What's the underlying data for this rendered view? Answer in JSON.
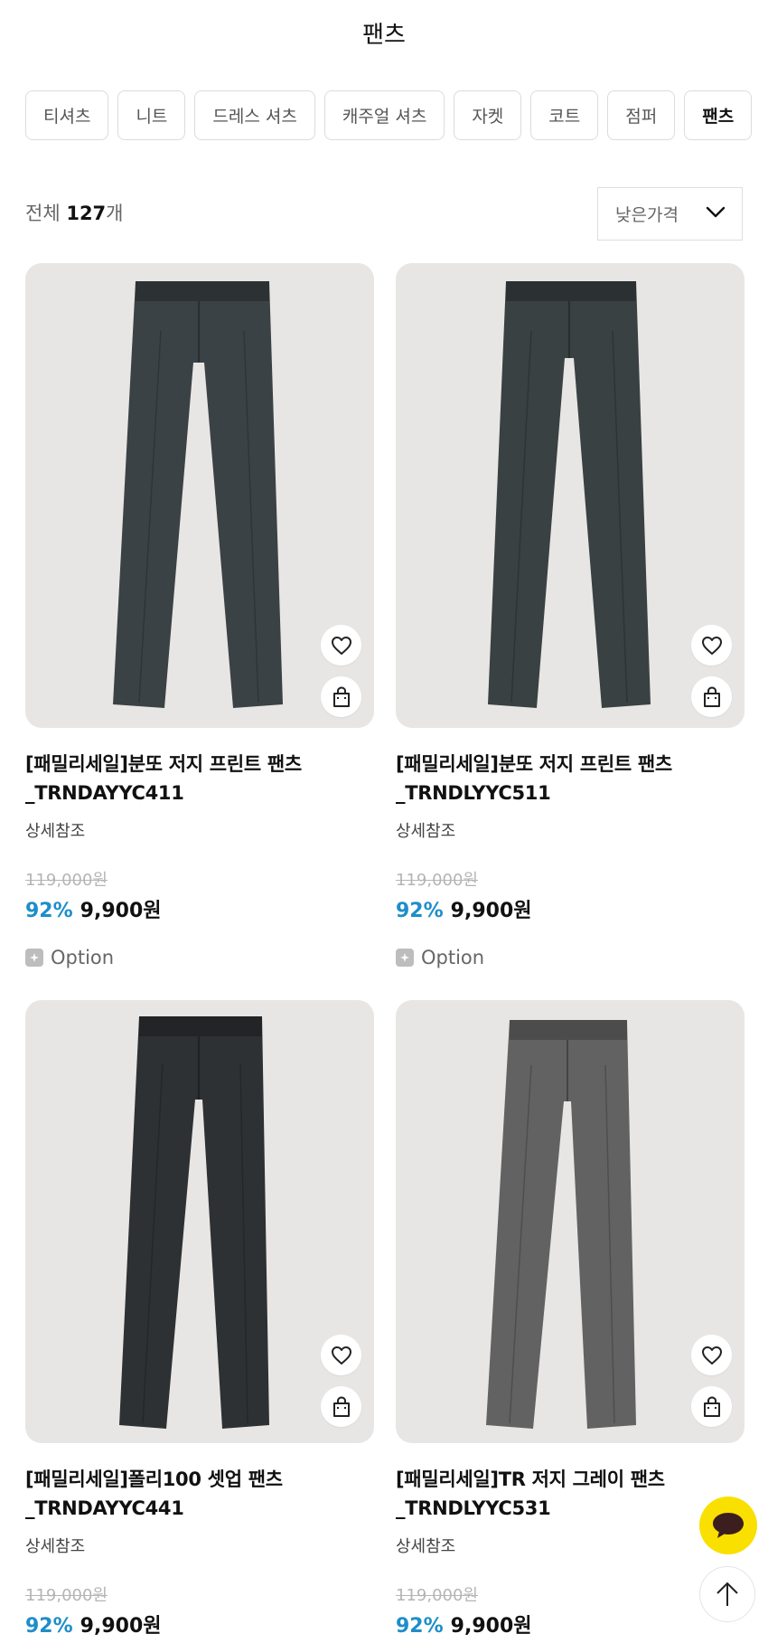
{
  "page_title": "팬츠",
  "categories": [
    {
      "label": "티셔츠",
      "active": false
    },
    {
      "label": "니트",
      "active": false
    },
    {
      "label": "드레스 셔츠",
      "active": false
    },
    {
      "label": "캐주얼 셔츠",
      "active": false
    },
    {
      "label": "자켓",
      "active": false
    },
    {
      "label": "코트",
      "active": false
    },
    {
      "label": "점퍼",
      "active": false
    },
    {
      "label": "팬츠",
      "active": true
    }
  ],
  "summary": {
    "prefix": "전체 ",
    "count": "127",
    "suffix": "개"
  },
  "sort": {
    "selected": "낮은가격",
    "icon": "chevron-down-icon"
  },
  "products": [
    {
      "name_line1": "[패밀리세일]분또 저지 프린트 팬츠",
      "name_line2": "_TRNDAYYC411",
      "desc": "상세참조",
      "original_price": "119,000원",
      "discount": "92%",
      "price": "9,900원",
      "option_label": "Option",
      "color": "#3b4245"
    },
    {
      "name_line1": "[패밀리세일]분또 저지 프린트 팬츠",
      "name_line2": "_TRNDLYYC511",
      "desc": "상세참조",
      "original_price": "119,000원",
      "discount": "92%",
      "price": "9,900원",
      "option_label": "Option",
      "color": "#3a4143"
    },
    {
      "name_line1": "[패밀리세일]폴리100 셋업 팬츠",
      "name_line2": "_TRNDAYYC441",
      "desc": "상세참조",
      "original_price": "119,000원",
      "discount": "92%",
      "price": "9,900원",
      "color": "#2e3133"
    },
    {
      "name_line1": "[패밀리세일]TR 저지 그레이 팬츠",
      "name_line2": "_TRNDLYYC531",
      "desc": "상세참조",
      "original_price": "119,000원",
      "discount": "92%",
      "price": "9,900원",
      "color": "#636262"
    }
  ],
  "colors": {
    "discount": "#1e8ec9",
    "chat_button": "#f9e000",
    "chat_bubble": "#3c1e1e",
    "thumb_bg": "#e8e6e4"
  },
  "icons": {
    "wishlist": "heart-icon",
    "cart": "shopping-bag-icon",
    "option": "option-icon",
    "chat": "chat-bubble-icon",
    "scroll_top": "arrow-up-icon"
  }
}
